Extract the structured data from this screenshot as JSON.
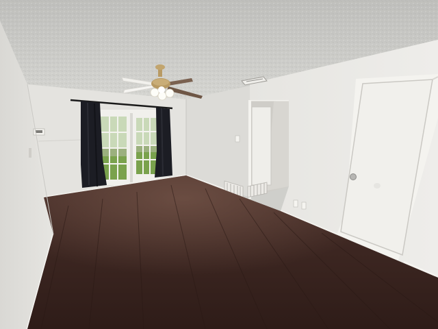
{
  "scene": {
    "type": "photo",
    "colors": {
      "ceiling": "#c9c9c6",
      "wall_light": "#e9e8e4",
      "wall_shadow": "#d4d3cf",
      "floor": "#3a2520",
      "floor_light": "#5a3d33",
      "curtain": "#1c1d24",
      "door": "#f2f1ee",
      "trim": "#f4f3ef",
      "grass": "#7aa24d",
      "fixture_brass": "#b89a63",
      "fan_blade": "#6e5645"
    }
  }
}
